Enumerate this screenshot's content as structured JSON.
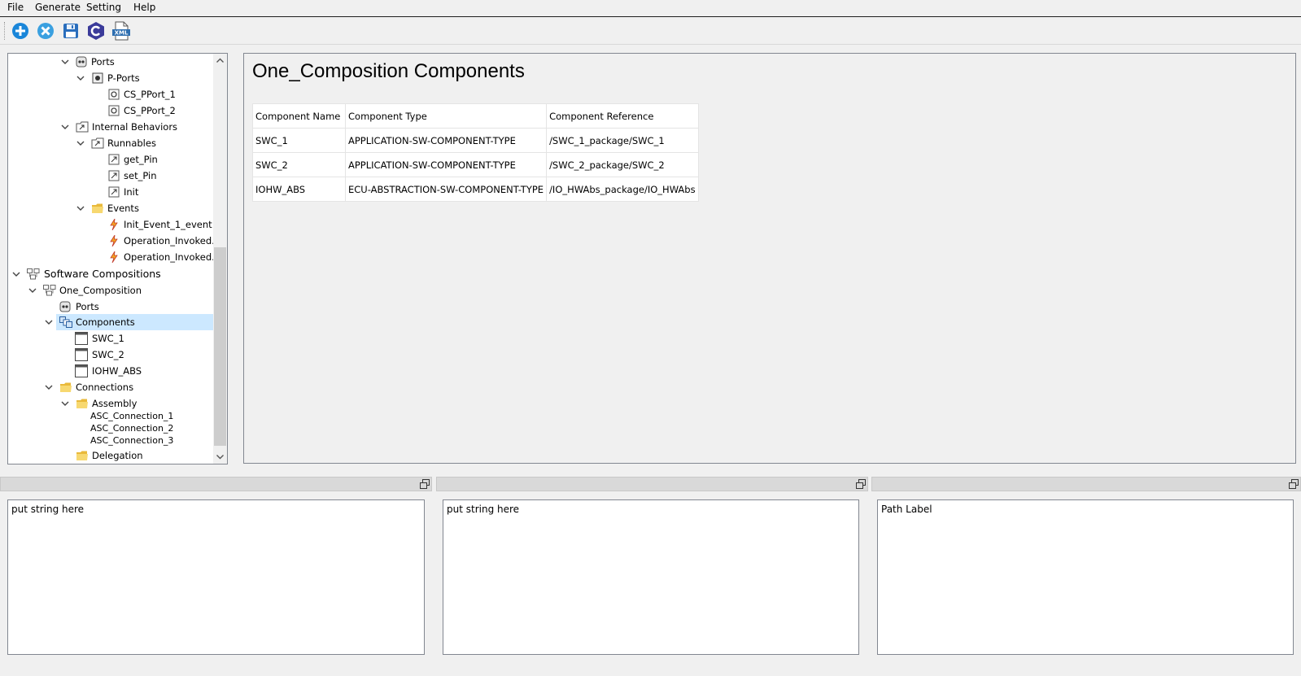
{
  "menu": [
    "File",
    "Generate",
    "Setting",
    "Help"
  ],
  "toolbar": {
    "buttons": [
      {
        "name": "add-icon",
        "color": "#1a86d9"
      },
      {
        "name": "delete-icon",
        "color": "#3aa0e0"
      },
      {
        "name": "save-icon",
        "color": "#2a6ebd"
      },
      {
        "name": "c-language-icon",
        "color": "#3b3b9a"
      },
      {
        "name": "xml-file-icon",
        "color": "#2f6fb0"
      }
    ]
  },
  "tree": {
    "items": [
      {
        "label": "Ports",
        "icon": "ports-icon"
      },
      {
        "label": "P-Ports",
        "icon": "p-port-icon"
      },
      {
        "label": "CS_PPort_1",
        "icon": "port-icon"
      },
      {
        "label": "CS_PPort_2",
        "icon": "port-icon"
      },
      {
        "label": "Internal Behaviors",
        "icon": "behavior-folder-icon"
      },
      {
        "label": "Runnables",
        "icon": "runnable-folder-icon"
      },
      {
        "label": "get_Pin",
        "icon": "runnable-icon"
      },
      {
        "label": "set_Pin",
        "icon": "runnable-icon"
      },
      {
        "label": "Init",
        "icon": "runnable-icon"
      },
      {
        "label": "Events",
        "icon": "folder-icon"
      },
      {
        "label": "Init_Event_1_event",
        "icon": "event-icon"
      },
      {
        "label": "Operation_Invoked...",
        "icon": "event-icon"
      },
      {
        "label": "Operation_Invoked...",
        "icon": "event-icon"
      },
      {
        "label": "Software Compositions",
        "icon": "composition-icon"
      },
      {
        "label": "One_Composition",
        "icon": "composition-icon"
      },
      {
        "label": "Ports",
        "icon": "ports-icon"
      },
      {
        "label": "Components",
        "icon": "components-icon"
      },
      {
        "label": "SWC_1",
        "icon": "component-icon"
      },
      {
        "label": "SWC_2",
        "icon": "component-icon"
      },
      {
        "label": "IOHW_ABS",
        "icon": "component-icon"
      },
      {
        "label": "Connections",
        "icon": "folder-icon"
      },
      {
        "label": "Assembly",
        "icon": "folder-icon"
      },
      {
        "label": "ASC_Connection_1",
        "icon": ""
      },
      {
        "label": "ASC_Connection_2",
        "icon": ""
      },
      {
        "label": "ASC_Connection_3",
        "icon": ""
      },
      {
        "label": "Delegation",
        "icon": "folder-icon"
      }
    ],
    "selected": "Components"
  },
  "main": {
    "title": "One_Composition Components",
    "columns": [
      "Component Name",
      "Component Type",
      "Component Reference"
    ],
    "rows": [
      [
        "SWC_1",
        "APPLICATION-SW-COMPONENT-TYPE",
        "/SWC_1_package/SWC_1"
      ],
      [
        "SWC_2",
        "APPLICATION-SW-COMPONENT-TYPE",
        "/SWC_2_package/SWC_2"
      ],
      [
        "IOHW_ABS",
        "ECU-ABSTRACTION-SW-COMPONENT-TYPE",
        "/IO_HWAbs_package/IO_HWAbs"
      ]
    ]
  },
  "bottom": {
    "panel1_text": "put string here",
    "panel2_text": "put string here",
    "panel3_text": "Path Label"
  }
}
